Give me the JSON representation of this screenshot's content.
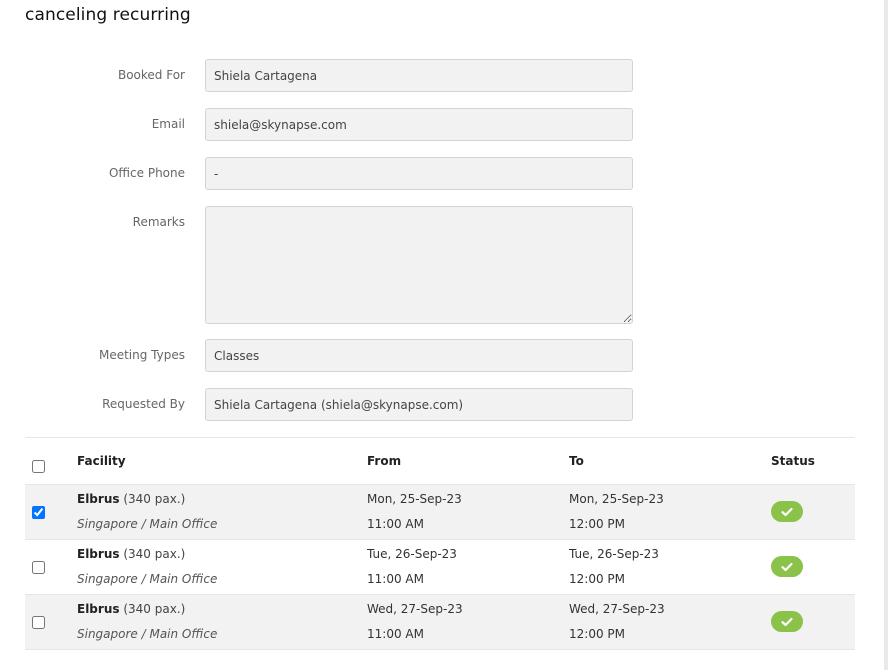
{
  "page": {
    "title": "canceling recurring"
  },
  "form": {
    "booked_for": {
      "label": "Booked For",
      "value": "Shiela Cartagena"
    },
    "email": {
      "label": "Email",
      "value": "shiela@skynapse.com"
    },
    "office_phone": {
      "label": "Office Phone",
      "value": "-"
    },
    "remarks": {
      "label": "Remarks",
      "value": ""
    },
    "meeting_types": {
      "label": "Meeting Types",
      "value": "Classes"
    },
    "requested_by": {
      "label": "Requested By",
      "value": "Shiela Cartagena (shiela@skynapse.com)"
    }
  },
  "table": {
    "headers": {
      "facility": "Facility",
      "from": "From",
      "to": "To",
      "status": "Status"
    },
    "select_all_checked": false,
    "rows": [
      {
        "checked": true,
        "facility": "Elbrus",
        "capacity": "(340 pax.)",
        "location": "Singapore / Main Office",
        "from_date": "Mon, 25-Sep-23",
        "from_time": "11:00 AM",
        "to_date": "Mon, 25-Sep-23",
        "to_time": "12:00 PM",
        "status_icon": "check-icon"
      },
      {
        "checked": false,
        "facility": "Elbrus",
        "capacity": "(340 pax.)",
        "location": "Singapore / Main Office",
        "from_date": "Tue, 26-Sep-23",
        "from_time": "11:00 AM",
        "to_date": "Tue, 26-Sep-23",
        "to_time": "12:00 PM",
        "status_icon": "check-icon"
      },
      {
        "checked": false,
        "facility": "Elbrus",
        "capacity": "(340 pax.)",
        "location": "Singapore / Main Office",
        "from_date": "Wed, 27-Sep-23",
        "from_time": "11:00 AM",
        "to_date": "Wed, 27-Sep-23",
        "to_time": "12:00 PM",
        "status_icon": "check-icon"
      }
    ]
  },
  "colors": {
    "status_ok": "#8bc34a",
    "alt_row": "#f2f2f2",
    "field_bg": "#f2f2f2"
  }
}
